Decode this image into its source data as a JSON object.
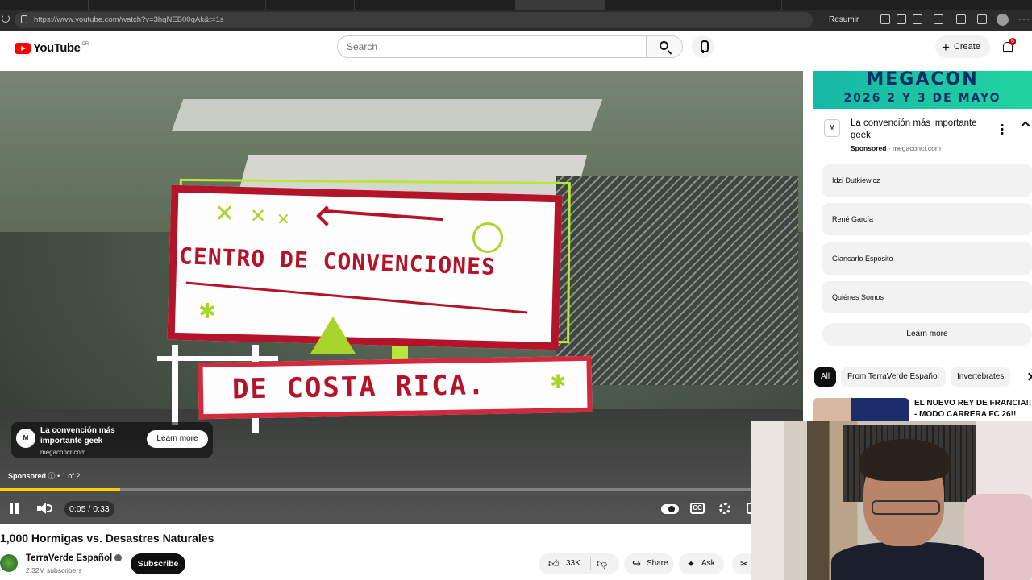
{
  "browser": {
    "url": "https://www.youtube.com/watch?v=3hgNEB00qAk&t=1s",
    "resumir_label": "Resumir"
  },
  "header": {
    "logo_text": "YouTube",
    "country_code": "CR",
    "search_placeholder": "Search",
    "create_label": "Create",
    "notification_count": "6"
  },
  "player": {
    "overlay_line1": "CENTRO DE CONVENCIONES",
    "overlay_line2": "DE COSTA RICA.",
    "ad": {
      "title": "La convención más importante geek",
      "domain": "megaconcr.com",
      "cta": "Learn more",
      "sponsored_label": "Sponsored",
      "ad_count": "• 1 of 2"
    },
    "time": "0:05 / 0:33",
    "progress": 0.15
  },
  "video": {
    "title": "1,000 Hormigas vs. Desastres Naturales",
    "channel": "TerraVerde Español",
    "subscribers": "2.32M subscribers",
    "subscribe_label": "Subscribe",
    "likes": "33K",
    "share_label": "Share",
    "ask_label": "Ask"
  },
  "sidebar_ad": {
    "banner_line1": "MEGACON",
    "banner_line2": "2026  2 Y 3 DE MAYO",
    "title": "La convención más importante geek",
    "sponsored_label": "Sponsored",
    "domain": "· megaconcr.com",
    "sitelinks": [
      "Idzi Dutkiewicz",
      "René García",
      "Giancarlo Esposito",
      "Quiénes Somos"
    ],
    "cta": "Learn more"
  },
  "chips": [
    "All",
    "From TerraVerde Español",
    "Invertebrates"
  ],
  "recommendation": {
    "title": "EL NUEVO REY DE FRANCIA!! - MODO CARRERA FC 26!!"
  },
  "colors": {
    "brand_red": "#ff0000",
    "progress": "#ffcc00",
    "overlay_red": "#b3142a",
    "overlay_green": "#a8d52c"
  }
}
